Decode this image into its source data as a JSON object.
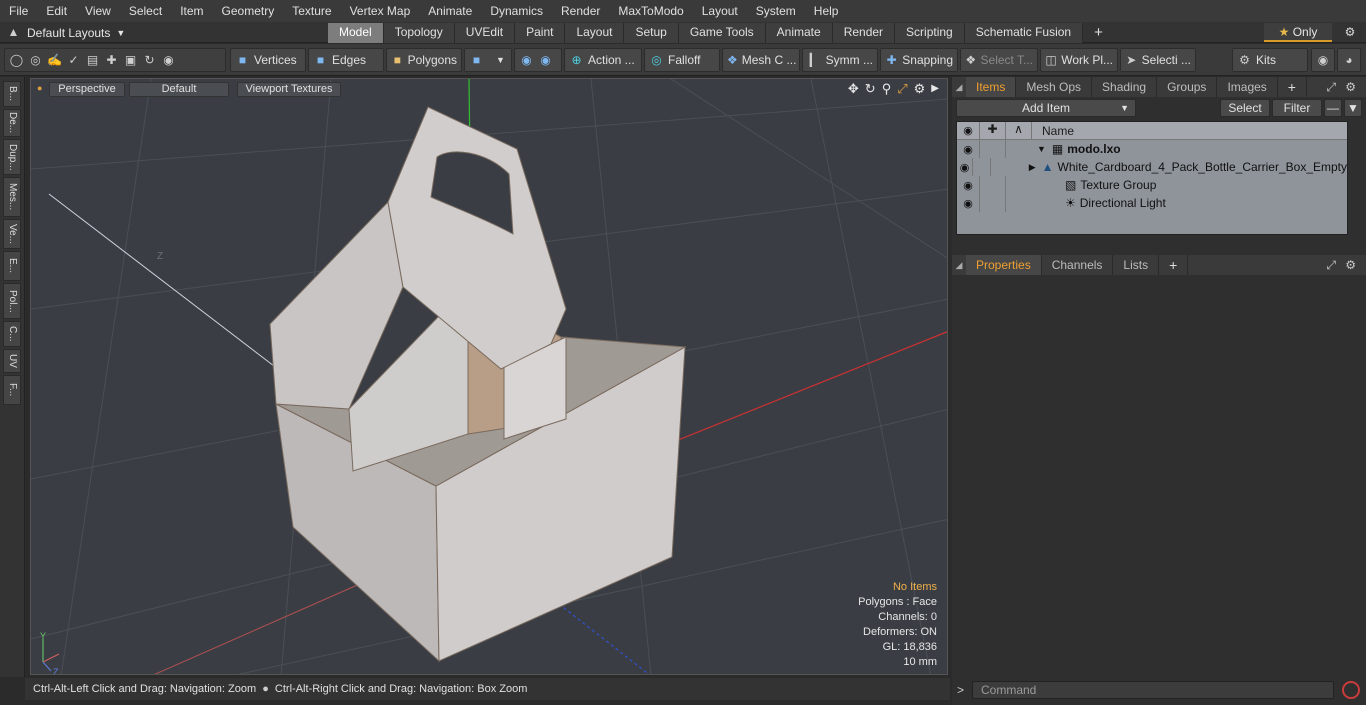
{
  "menu": [
    "File",
    "Edit",
    "View",
    "Select",
    "Item",
    "Geometry",
    "Texture",
    "Vertex Map",
    "Animate",
    "Dynamics",
    "Render",
    "MaxToModo",
    "Layout",
    "System",
    "Help"
  ],
  "layout_row": {
    "layout_label": "Default Layouts",
    "tabs": [
      "Model",
      "Topology",
      "UVEdit",
      "Paint",
      "Layout",
      "Setup",
      "Game Tools",
      "Animate",
      "Render",
      "Scripting",
      "Schematic Fusion"
    ],
    "active_tab": "Model",
    "only_label": "Only"
  },
  "toolbar": {
    "vertices": "Vertices",
    "edges": "Edges",
    "polygons": "Polygons",
    "action": "Action ...",
    "falloff": "Falloff",
    "mesh": "Mesh C ...",
    "symm": "Symm ...",
    "snapping": "Snapping",
    "select_t": "Select T...",
    "work_pl": "Work Pl...",
    "selecti": "Selecti ...",
    "kits": "Kits"
  },
  "left_tabs": [
    "B...",
    "De...",
    "Dup...",
    "Mes...",
    "Ve...",
    "E...",
    "Pol...",
    "C...",
    "UV",
    "F..."
  ],
  "viewport": {
    "view_mode": "Perspective",
    "shading": "Default",
    "texture_mode": "Viewport Textures",
    "axis_label": "Z",
    "stats": {
      "items": "No Items",
      "polygons": "Polygons : Face",
      "channels": "Channels: 0",
      "deformers": "Deformers: ON",
      "gl": "GL: 18,836",
      "scale": "10 mm"
    }
  },
  "status_bar": {
    "hint1": "Ctrl-Alt-Left Click and Drag: Navigation: Zoom",
    "hint2": "Ctrl-Alt-Right Click and Drag: Navigation: Box Zoom"
  },
  "items_panel": {
    "tabs": [
      "Items",
      "Mesh Ops",
      "Shading",
      "Groups",
      "Images"
    ],
    "active_tab": "Items",
    "add_item": "Add Item",
    "select": "Select",
    "filter": "Filter",
    "column_name": "Name",
    "rows": [
      {
        "label": "modo.lxo",
        "indent": 0,
        "bold": true
      },
      {
        "label": "White_Cardboard_4_Pack_Bottle_Carrier_Box_Empty",
        "indent": 1
      },
      {
        "label": "Texture Group",
        "indent": 1
      },
      {
        "label": "Directional Light",
        "indent": 1
      }
    ]
  },
  "properties_panel": {
    "tabs": [
      "Properties",
      "Channels",
      "Lists"
    ],
    "active_tab": "Properties",
    "command_placeholder": "Command"
  },
  "colors": {
    "accent": "#f0a030",
    "active_tab": "#7d7d7d",
    "grid_bg": "#3a3e44",
    "x_axis": "#d03030",
    "y_axis": "#30c030",
    "z_axis": "#3050d0"
  }
}
